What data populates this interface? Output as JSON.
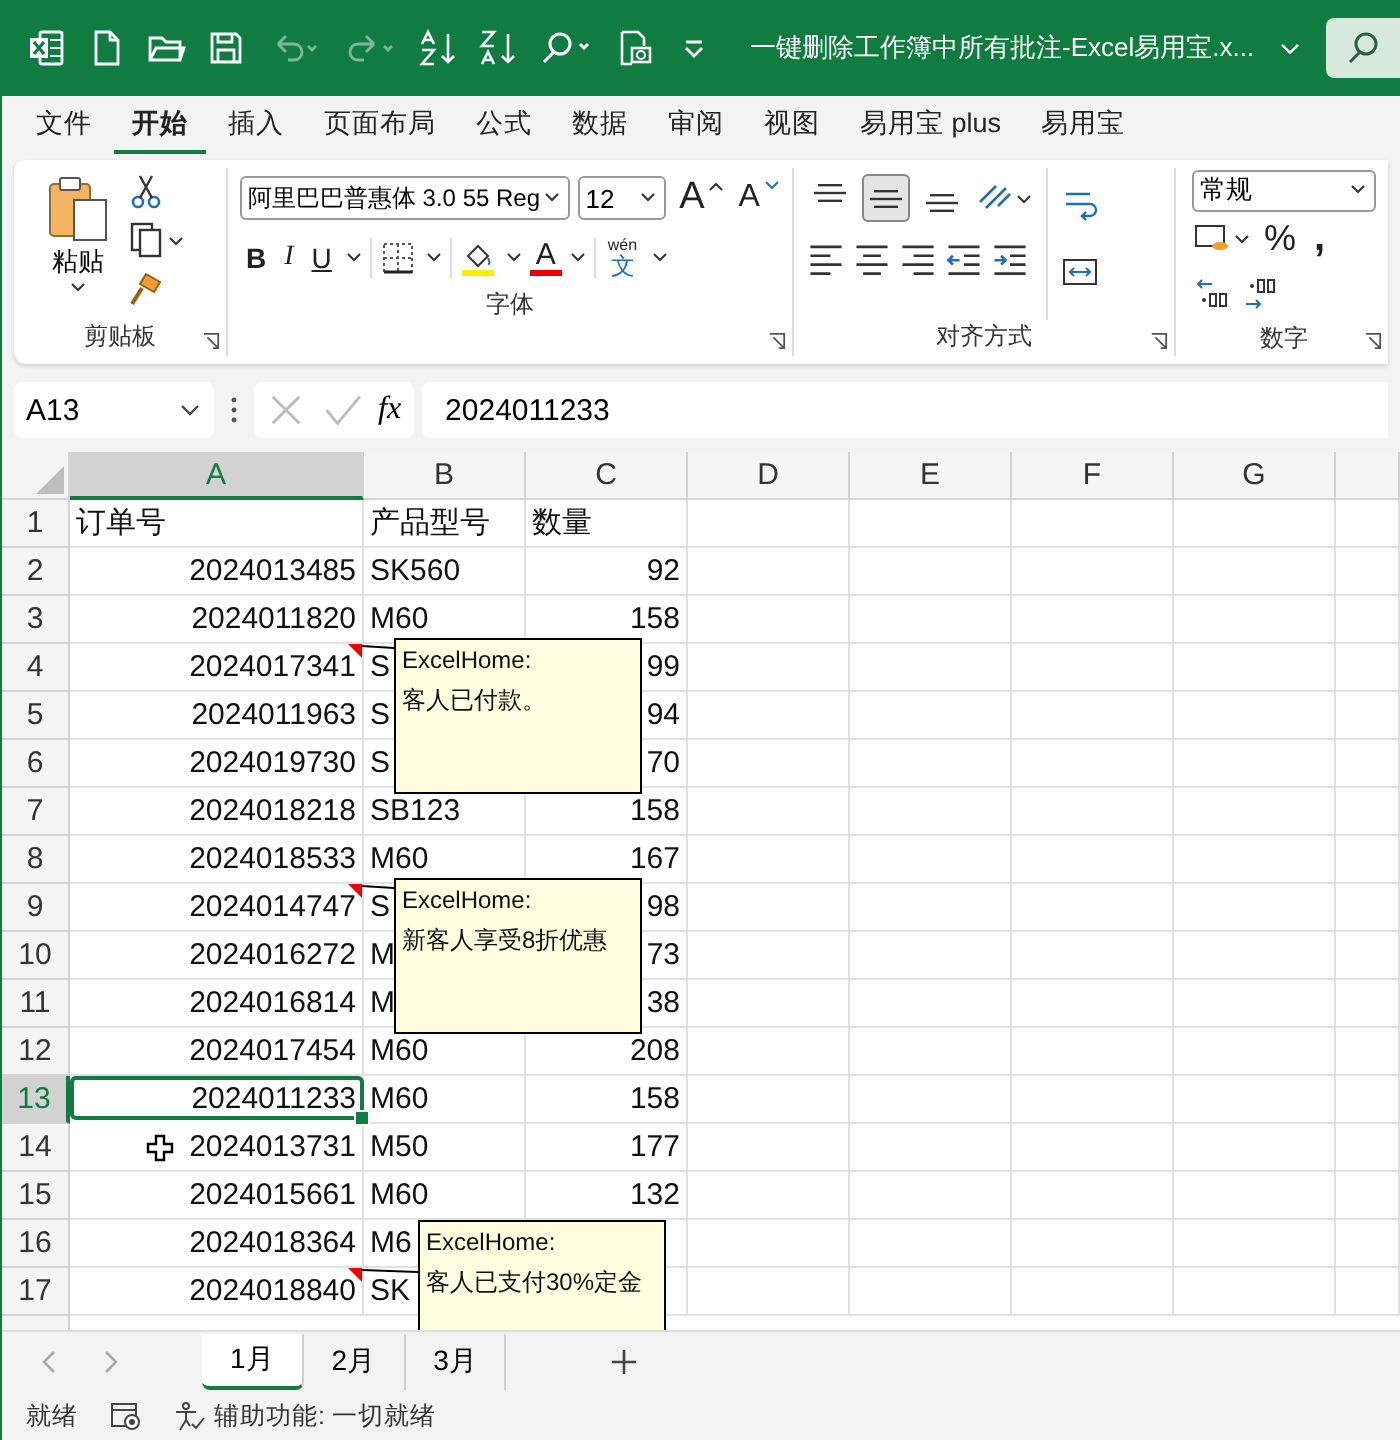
{
  "title_bar": {
    "title": "一键删除工作簿中所有批注-Excel易用宝.x..."
  },
  "menu_tabs": [
    {
      "label": "文件",
      "selected": false
    },
    {
      "label": "开始",
      "selected": true
    },
    {
      "label": "插入",
      "selected": false
    },
    {
      "label": "页面布局",
      "selected": false
    },
    {
      "label": "公式",
      "selected": false
    },
    {
      "label": "数据",
      "selected": false
    },
    {
      "label": "审阅",
      "selected": false
    },
    {
      "label": "视图",
      "selected": false
    },
    {
      "label": "易用宝 plus",
      "selected": false
    },
    {
      "label": "易用宝",
      "selected": false
    }
  ],
  "ribbon": {
    "clipboard": {
      "paste": "粘贴",
      "label": "剪贴板"
    },
    "font": {
      "font_name": "阿里巴巴普惠体 3.0 55 Reg",
      "font_size": "12",
      "bold": "B",
      "italic": "I",
      "underline": "U",
      "font_color": "A",
      "grow": "A",
      "shrink": "A",
      "phonetic": "wén",
      "phonetic_char": "文",
      "label": "字体"
    },
    "alignment": {
      "buttons": [
        {
          "kind": "top",
          "selected": false
        },
        {
          "kind": "middle",
          "selected": true
        },
        {
          "kind": "bottom",
          "selected": false
        }
      ],
      "label": "对齐方式"
    },
    "number": {
      "format": "常规",
      "percent": "%",
      "comma": ",",
      "label": "数字"
    }
  },
  "formula_bar": {
    "name_box": "A13",
    "fx": "fx",
    "value": "2024011233"
  },
  "columns": [
    {
      "label": "A",
      "selected": true
    },
    {
      "label": "B",
      "selected": false
    },
    {
      "label": "C",
      "selected": false
    },
    {
      "label": "D",
      "selected": false
    },
    {
      "label": "E",
      "selected": false
    },
    {
      "label": "F",
      "selected": false
    },
    {
      "label": "G",
      "selected": false
    }
  ],
  "rows": [
    {
      "number": "1",
      "kind": "header",
      "selected": false,
      "cells": [
        "订单号",
        "产品型号",
        "数量"
      ]
    },
    {
      "number": "2",
      "kind": "data",
      "selected": false,
      "cells": [
        "2024013485",
        "SK560",
        "92"
      ]
    },
    {
      "number": "3",
      "kind": "data",
      "selected": false,
      "cells": [
        "2024011820",
        "M60",
        "158"
      ]
    },
    {
      "number": "4",
      "kind": "data",
      "selected": false,
      "cells": [
        "2024017341",
        "S",
        "99"
      ],
      "comment": {
        "author": "ExcelHome:",
        "text": "客人已付款。"
      }
    },
    {
      "number": "5",
      "kind": "data",
      "selected": false,
      "cells": [
        "2024011963",
        "S",
        "94"
      ]
    },
    {
      "number": "6",
      "kind": "data",
      "selected": false,
      "cells": [
        "2024019730",
        "S",
        "70"
      ]
    },
    {
      "number": "7",
      "kind": "data",
      "selected": false,
      "cells": [
        "2024018218",
        "SB123",
        "158"
      ]
    },
    {
      "number": "8",
      "kind": "data",
      "selected": false,
      "cells": [
        "2024018533",
        "M60",
        "167"
      ]
    },
    {
      "number": "9",
      "kind": "data",
      "selected": false,
      "cells": [
        "2024014747",
        "S",
        "98"
      ],
      "comment": {
        "author": "ExcelHome:",
        "text": "新客人享受8折优惠"
      }
    },
    {
      "number": "10",
      "kind": "data",
      "selected": false,
      "cells": [
        "2024016272",
        "M",
        "73"
      ]
    },
    {
      "number": "11",
      "kind": "data",
      "selected": false,
      "cells": [
        "2024016814",
        "M",
        "38"
      ]
    },
    {
      "number": "12",
      "kind": "data",
      "selected": false,
      "cells": [
        "2024017454",
        "M60",
        "208"
      ]
    },
    {
      "number": "13",
      "kind": "data",
      "selected": true,
      "cells": [
        "2024011233",
        "M60",
        "158"
      ]
    },
    {
      "number": "14",
      "kind": "data",
      "selected": false,
      "cells": [
        "2024013731",
        "M50",
        "177"
      ]
    },
    {
      "number": "15",
      "kind": "data",
      "selected": false,
      "cells": [
        "2024015661",
        "M60",
        "132"
      ]
    },
    {
      "number": "16",
      "kind": "data",
      "selected": false,
      "cells": [
        "2024018364",
        "M6",
        ""
      ]
    },
    {
      "number": "17",
      "kind": "data",
      "selected": false,
      "cells": [
        "2024018840",
        "SK",
        ""
      ],
      "comment": {
        "author": "ExcelHome:",
        "text": "客人已支付30%定金"
      }
    }
  ],
  "sheet_tabs": [
    {
      "label": "1月",
      "selected": true
    },
    {
      "label": "2月",
      "selected": false
    },
    {
      "label": "3月",
      "selected": false
    }
  ],
  "status_bar": {
    "mode": "就绪",
    "accessibility": "辅助功能: 一切就绪"
  }
}
